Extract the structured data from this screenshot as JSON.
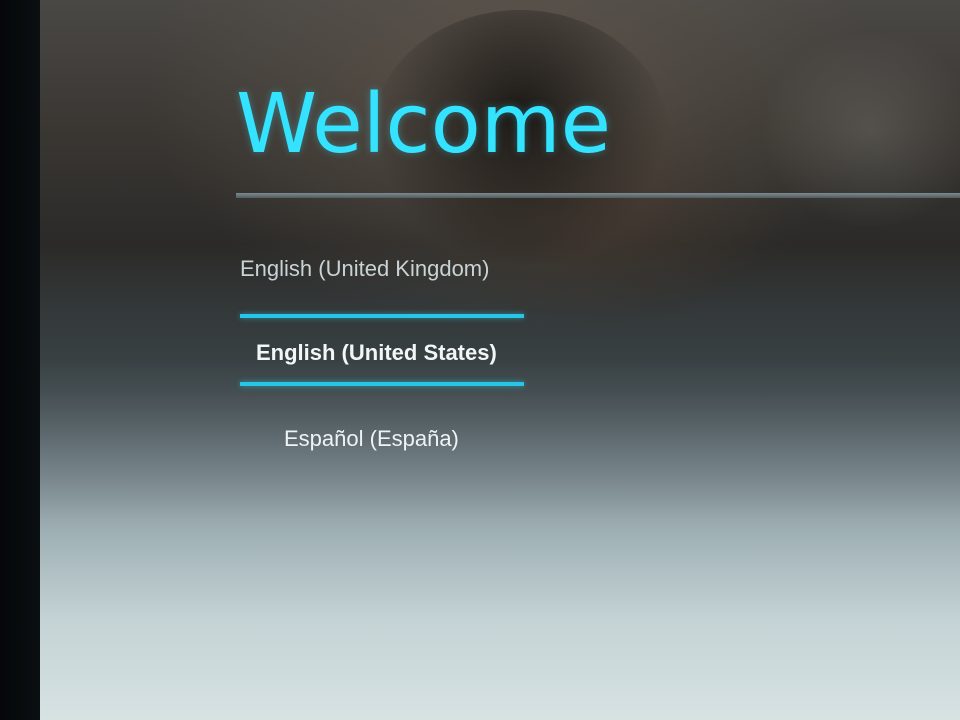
{
  "screen": {
    "title": "Welcome",
    "languages": [
      {
        "label": "English (United Kingdom)",
        "selected": false
      },
      {
        "label": "English (United States)",
        "selected": true
      },
      {
        "label": "Español (España)",
        "selected": false
      }
    ]
  },
  "colors": {
    "accent": "#33e3ff",
    "selection_line": "#27c5e6"
  }
}
